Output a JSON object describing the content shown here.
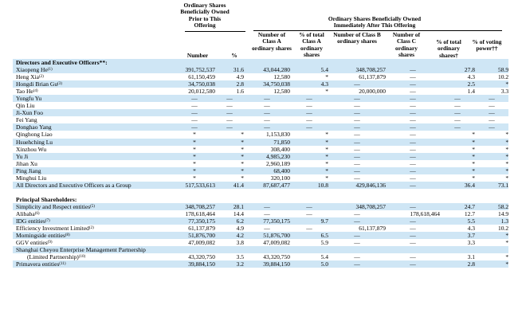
{
  "header": {
    "prior": "Ordinary Shares Beneficially Owned Prior to This Offering",
    "after": "Ordinary Shares Beneficially Owned Immediately After This Offering",
    "cols": {
      "number": "Number",
      "pct": "%",
      "num_a": "Number of Class A ordinary shares",
      "pct_a": "% of total Class A ordinary shares",
      "num_b": "Number of Class B ordinary shares",
      "num_c": "Number of Class C ordinary shares",
      "pct_total": "% of total ordinary shares†",
      "pct_vote": "% of voting power††"
    }
  },
  "rows": [
    {
      "type": "section",
      "name": "Directors and Executive Officers**:"
    },
    {
      "name": "Xiaopeng He",
      "ref": "(1)",
      "c": [
        "391,752,537",
        "31.6",
        "43,044,280",
        "5.4",
        "348,708,257",
        "—",
        "27.8",
        "58.9"
      ]
    },
    {
      "name": "Heng Xia",
      "ref": "(2)",
      "c": [
        "61,150,459",
        "4.9",
        "12,580",
        "*",
        "61,137,879",
        "—",
        "4.3",
        "10.2"
      ]
    },
    {
      "name": "Hongdi Brian Gu",
      "ref": "(3)",
      "c": [
        "34,750,038",
        "2.8",
        "34,750,038",
        "4.3",
        "—",
        "—",
        "2.5",
        "*"
      ]
    },
    {
      "name": "Tao He",
      "ref": "(4)",
      "c": [
        "20,012,580",
        "1.6",
        "12,580",
        "*",
        "20,000,000",
        "—",
        "1.4",
        "3.3"
      ]
    },
    {
      "name": "Yongfu Yu",
      "ref": "",
      "c": [
        "—",
        "—",
        "—",
        "—",
        "—",
        "—",
        "—",
        "—"
      ]
    },
    {
      "name": "Qin Liu",
      "ref": "",
      "c": [
        "—",
        "—",
        "—",
        "—",
        "—",
        "—",
        "—",
        "—"
      ]
    },
    {
      "name": "Ji-Xun Foo",
      "ref": "",
      "c": [
        "—",
        "—",
        "—",
        "—",
        "—",
        "—",
        "—",
        "—"
      ]
    },
    {
      "name": "Fei Yang",
      "ref": "",
      "c": [
        "—",
        "—",
        "—",
        "—",
        "—",
        "—",
        "—",
        "—"
      ]
    },
    {
      "name": "Donghao Yang",
      "ref": "",
      "c": [
        "—",
        "—",
        "—",
        "—",
        "—",
        "—",
        "—",
        "—"
      ]
    },
    {
      "name": "Qinghong Liao",
      "ref": "",
      "c": [
        "*",
        "*",
        "1,153,830",
        "*",
        "—",
        "—",
        "*",
        "*"
      ]
    },
    {
      "name": "Hsuehching Lu",
      "ref": "",
      "c": [
        "*",
        "*",
        "71,850",
        "*",
        "—",
        "—",
        "*",
        "*"
      ]
    },
    {
      "name": "Xinzhou Wu",
      "ref": "",
      "c": [
        "*",
        "*",
        "308,400",
        "*",
        "—",
        "—",
        "*",
        "*"
      ]
    },
    {
      "name": "Yu Ji",
      "ref": "",
      "c": [
        "*",
        "*",
        "4,985,230",
        "*",
        "—",
        "—",
        "*",
        "*"
      ]
    },
    {
      "name": "Jihan Xu",
      "ref": "",
      "c": [
        "*",
        "*",
        "2,960,189",
        "*",
        "—",
        "—",
        "*",
        "*"
      ]
    },
    {
      "name": "Ping Jiang",
      "ref": "",
      "c": [
        "*",
        "*",
        "68,400",
        "*",
        "—",
        "—",
        "*",
        "*"
      ]
    },
    {
      "name": "Minghui Liu",
      "ref": "",
      "c": [
        "*",
        "*",
        "320,100",
        "*",
        "—",
        "—",
        "*",
        "*"
      ]
    },
    {
      "name": "All Directors and Executive Officers as a Group",
      "ref": "",
      "c": [
        "517,533,613",
        "41.4",
        "87,687,477",
        "10.8",
        "429,846,136",
        "—",
        "36.4",
        "73.1"
      ]
    },
    {
      "type": "spacer"
    },
    {
      "type": "section",
      "name": "Principal Shareholders:"
    },
    {
      "name": "Simplicity and Respect entities",
      "ref": "(5)",
      "c": [
        "348,708,257",
        "28.1",
        "—",
        "—",
        "348,708,257",
        "—",
        "24.7",
        "58.2"
      ]
    },
    {
      "name": "Alibaba",
      "ref": "(6)",
      "c": [
        "178,618,464",
        "14.4",
        "—",
        "—",
        "—",
        "178,618,464",
        "12.7",
        "14.9"
      ]
    },
    {
      "name": "IDG entities",
      "ref": "(7)",
      "c": [
        "77,350,175",
        "6.2",
        "77,350,175",
        "9.7",
        "—",
        "—",
        "5.5",
        "1.3"
      ]
    },
    {
      "name": "Efficiency Investment Limited",
      "ref": "(2)",
      "c": [
        "61,137,879",
        "4.9",
        "—",
        "—",
        "61,137,879",
        "—",
        "4.3",
        "10.2"
      ]
    },
    {
      "name": "Morningside entities",
      "ref": "(8)",
      "c": [
        "51,876,700",
        "4.2",
        "51,876,700",
        "6.5",
        "—",
        "—",
        "3.7",
        "*"
      ]
    },
    {
      "name": "GGV entities",
      "ref": "(9)",
      "c": [
        "47,009,082",
        "3.8",
        "47,009,082",
        "5.9",
        "—",
        "—",
        "3.3",
        "*"
      ]
    },
    {
      "name": "Shanghai Cheyou Enterprise Management Partnership",
      "ref": "",
      "type": "label"
    },
    {
      "name": "(Limited Partnership)",
      "ref": "(10)",
      "indent": true,
      "c": [
        "43,320,750",
        "3.5",
        "43,320,750",
        "5.4",
        "—",
        "—",
        "3.1",
        "*"
      ]
    },
    {
      "name": "Primavera entities",
      "ref": "(11)",
      "c": [
        "39,884,150",
        "3.2",
        "39,884,150",
        "5.0",
        "—",
        "—",
        "2.8",
        "*"
      ]
    }
  ]
}
